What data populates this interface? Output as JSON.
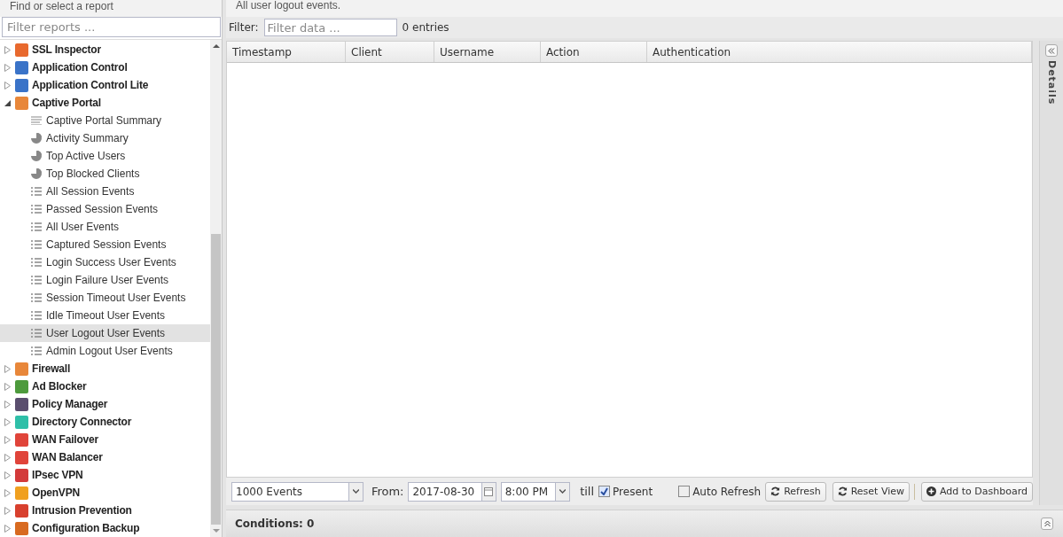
{
  "sidebar": {
    "title": "Find or select a report",
    "filter_placeholder": "Filter reports ...",
    "tree": [
      {
        "label": "SSL Inspector",
        "color": "#e8692e",
        "expanded": false
      },
      {
        "label": "Application Control",
        "color": "#3a73c8",
        "expanded": false
      },
      {
        "label": "Application Control Lite",
        "color": "#3a73c8",
        "expanded": false
      },
      {
        "label": "Captive Portal",
        "color": "#e8873a",
        "expanded": true,
        "children": [
          {
            "label": "Captive Portal Summary",
            "kind": "text",
            "selected": false
          },
          {
            "label": "Activity Summary",
            "kind": "pie",
            "selected": false
          },
          {
            "label": "Top Active Users",
            "kind": "pie",
            "selected": false
          },
          {
            "label": "Top Blocked Clients",
            "kind": "pie",
            "selected": false
          },
          {
            "label": "All Session Events",
            "kind": "list",
            "selected": false
          },
          {
            "label": "Passed Session Events",
            "kind": "list",
            "selected": false
          },
          {
            "label": "All User Events",
            "kind": "list",
            "selected": false
          },
          {
            "label": "Captured Session Events",
            "kind": "list",
            "selected": false
          },
          {
            "label": "Login Success User Events",
            "kind": "list",
            "selected": false
          },
          {
            "label": "Login Failure User Events",
            "kind": "list",
            "selected": false
          },
          {
            "label": "Session Timeout User Events",
            "kind": "list",
            "selected": false
          },
          {
            "label": "Idle Timeout User Events",
            "kind": "list",
            "selected": false
          },
          {
            "label": "User Logout User Events",
            "kind": "list",
            "selected": true
          },
          {
            "label": "Admin Logout User Events",
            "kind": "list",
            "selected": false
          }
        ]
      },
      {
        "label": "Firewall",
        "color": "#e8873a",
        "expanded": false
      },
      {
        "label": "Ad Blocker",
        "color": "#4d9a3c",
        "expanded": false
      },
      {
        "label": "Policy Manager",
        "color": "#5a4e6e",
        "expanded": false
      },
      {
        "label": "Directory Connector",
        "color": "#2fbfa8",
        "expanded": false
      },
      {
        "label": "WAN Failover",
        "color": "#e0443a",
        "expanded": false
      },
      {
        "label": "WAN Balancer",
        "color": "#e0443a",
        "expanded": false
      },
      {
        "label": "IPsec VPN",
        "color": "#d33a3a",
        "expanded": false
      },
      {
        "label": "OpenVPN",
        "color": "#f0a020",
        "expanded": false
      },
      {
        "label": "Intrusion Prevention",
        "color": "#d8402e",
        "expanded": false
      },
      {
        "label": "Configuration Backup",
        "color": "#d86a20",
        "expanded": false
      }
    ]
  },
  "report": {
    "description": "All user logout events.",
    "filter_label": "Filter:",
    "filter_placeholder": "Filter data ...",
    "entries": "0 entries",
    "columns": [
      "Timestamp",
      "Client",
      "Username",
      "Action",
      "Authentication"
    ],
    "details_label": "Details",
    "toolbar": {
      "limit": "1000 Events",
      "from_label": "From:",
      "date": "2017-08-30",
      "time": "8:00 PM",
      "till_label": "till",
      "present": {
        "label": "Present",
        "checked": true
      },
      "auto_refresh": {
        "label": "Auto Refresh",
        "checked": false
      },
      "buttons": [
        {
          "label": "Refresh",
          "kind": "refresh"
        },
        {
          "label": "Reset View",
          "kind": "refresh"
        },
        {
          "label": "Add to Dashboard",
          "kind": "add"
        }
      ]
    },
    "conditions": "Conditions: 0"
  }
}
